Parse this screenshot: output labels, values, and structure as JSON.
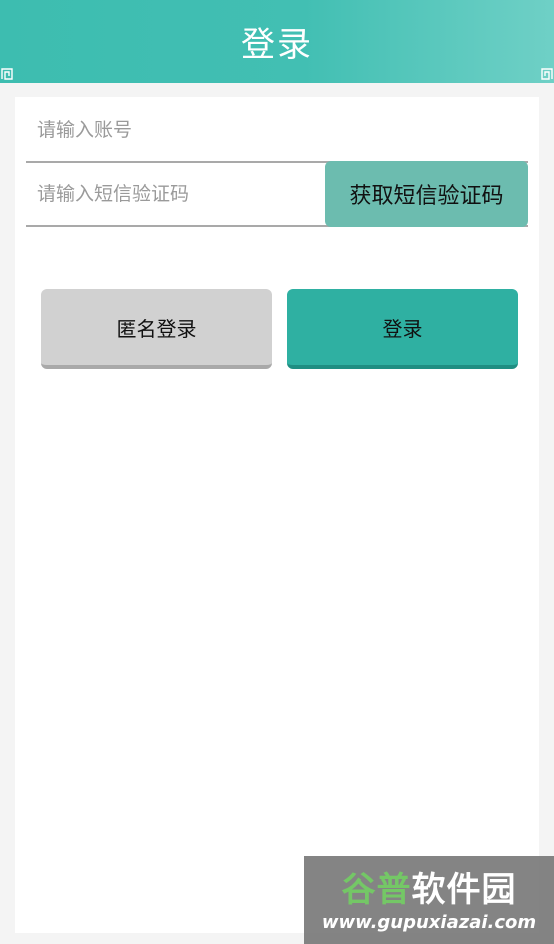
{
  "header": {
    "title": "登录"
  },
  "form": {
    "account_placeholder": "请输入账号",
    "account_value": "",
    "code_placeholder": "请输入短信验证码",
    "code_value": "",
    "get_code_label": "获取短信验证码"
  },
  "actions": {
    "anonymous_login_label": "匿名登录",
    "login_label": "登录"
  },
  "watermark": {
    "brand_part1": "谷普",
    "brand_part2": "软件园",
    "url": "www.gupuxiazai.com"
  },
  "colors": {
    "header": "#3dbdb0",
    "sms_button": "#6cbcaf",
    "login_button": "#2fb0a2",
    "anonymous_button": "#d1d1d1"
  }
}
